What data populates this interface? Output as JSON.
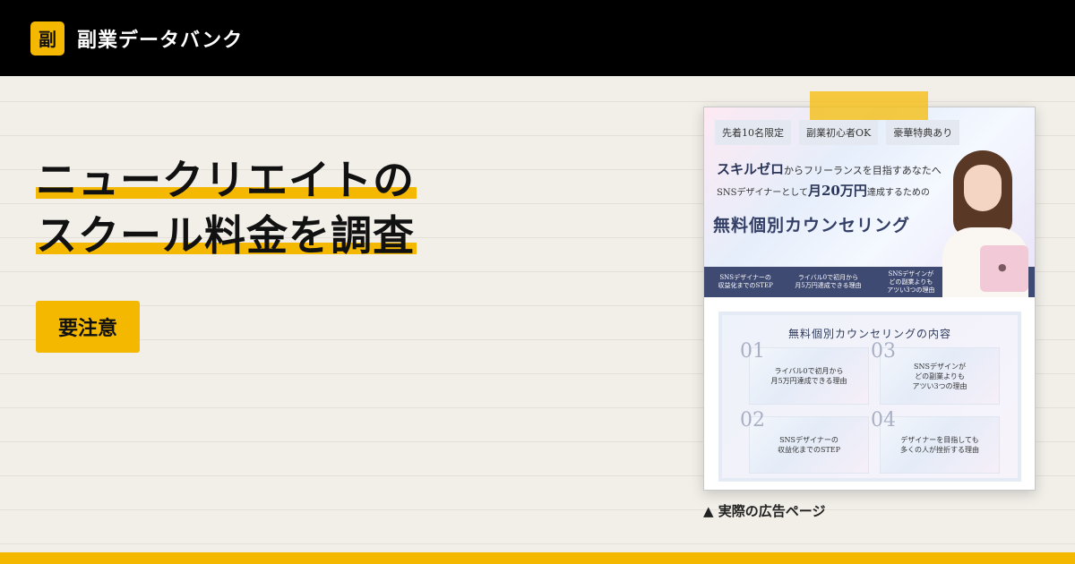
{
  "header": {
    "logo_char": "副",
    "site_name": "副業データバンク"
  },
  "hero": {
    "title_line1": "ニュークリエイトの",
    "title_line2": "スクール料金を調査",
    "warning_label": "要注意"
  },
  "ad": {
    "tags": [
      "先着10名限定",
      "副業初心者OK",
      "豪華特典あり"
    ],
    "line1_emphasis": "スキルゼロ",
    "line1_rest": "からフリーランスを目指すあなたへ",
    "line2_pre": "SNSデザイナーとして",
    "line2_emphasis": "月20万円",
    "line2_post": "達成するための",
    "main_title": "無料個別カウンセリング",
    "band_items": [
      "SNSデザイナーの\n収益化までのSTEP",
      "ライバル0で初月から\n月5万円達成できる理由",
      "SNSデザインが\nどの副業よりも\nアツい3つの理由"
    ],
    "content_title": "無料個別カウンセリングの内容",
    "content_items": [
      {
        "num": "01",
        "text": "ライバル0で初月から\n月5万円達成できる理由"
      },
      {
        "num": "03",
        "text": "SNSデザインが\nどの副業よりも\nアツい3つの理由"
      },
      {
        "num": "02",
        "text": "SNSデザイナーの\n収益化までのSTEP"
      },
      {
        "num": "04",
        "text": "デザイナーを目指しても\n多くの人が挫折する理由"
      }
    ],
    "laptop_logo": ""
  },
  "caption": "▲ 実際の広告ページ",
  "colors": {
    "accent": "#f5b800",
    "header_bg": "#000000",
    "page_bg": "#f2efe9",
    "ad_navy": "#3f4a72"
  }
}
